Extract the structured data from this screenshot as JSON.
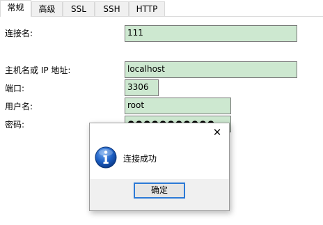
{
  "tabs": [
    {
      "label": "常规"
    },
    {
      "label": "高级"
    },
    {
      "label": "SSL"
    },
    {
      "label": "SSH"
    },
    {
      "label": "HTTP"
    }
  ],
  "form": {
    "connection_name_label": "连接名:",
    "connection_name_value": "111",
    "host_label": "主机名或 IP 地址:",
    "host_value": "localhost",
    "port_label": "端口:",
    "port_value": "3306",
    "username_label": "用户名:",
    "username_value": "root",
    "password_label": "密码:",
    "password_value": "●●●●●●●●●●●"
  },
  "dialog": {
    "close_glyph": "✕",
    "message": "连接成功",
    "ok_label": "确定"
  }
}
